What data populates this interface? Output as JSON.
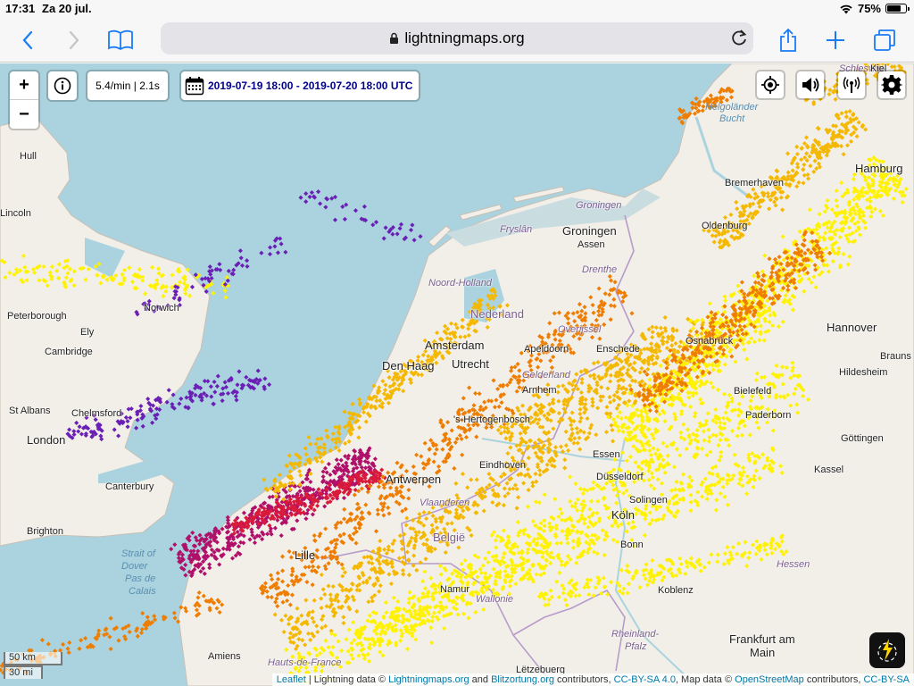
{
  "status_bar": {
    "time": "17:31",
    "date": "Za 20 jul.",
    "battery": "75%",
    "battery_level": 0.75,
    "icons": [
      "wifi-icon",
      "battery-icon"
    ]
  },
  "browser": {
    "url": "lightningmaps.org",
    "icons": [
      "back-chevron-icon",
      "forward-chevron-icon",
      "bookmarks-icon",
      "lock-icon",
      "reload-icon",
      "share-icon",
      "new-tab-icon",
      "tabs-icon"
    ]
  },
  "map_controls": {
    "zoom_in": "+",
    "zoom_out": "−",
    "rate": "5.4/min | 2.1s",
    "period": "2019-07-19 18:00 - 2019-07-20 18:00 UTC",
    "right_icons": [
      "locate-icon",
      "sound-icon",
      "stations-icon",
      "settings-icon"
    ]
  },
  "scale": {
    "km": "50 km",
    "mi": "30 mi"
  },
  "attribution": {
    "leaflet": "Leaflet",
    "sep1": " | Lightning data © ",
    "lm": "Lightningmaps.org",
    "and": " and ",
    "bo": "Blitzortung.org",
    "contrib": " contributors, ",
    "cc1": "CC-BY-SA 4.0",
    "mapdata": ", Map data © ",
    "osm": "OpenStreetMap",
    "contrib2": " contributors, ",
    "cc2": "CC-BY-SA"
  },
  "labels": {
    "hull": "Hull",
    "lincoln": "Lincoln",
    "peterborough": "Peterborough",
    "norwich": "Norwich",
    "ely": "Ely",
    "cambridge": "Cambridge",
    "st_albans": "St Albans",
    "chelmsford": "Chelmsford",
    "london": "London",
    "canterbury": "Canterbury",
    "brighton": "Brighton",
    "strait": "Strait of",
    "dover": "Dover",
    "pas": "Pas de",
    "calais": "Calais",
    "lille": "Lille",
    "amiens": "Amiens",
    "hauts": "Hauts-de-France",
    "groningen_prov": "Groningen",
    "groningen": "Groningen",
    "friesland": "Fryslân",
    "assen": "Assen",
    "drenthe": "Drenthe",
    "noord_holland": "Noord-Holland",
    "nederland": "Nederland",
    "amsterdam": "Amsterdam",
    "overijssel": "Overijssel",
    "apeldoorn": "Apeldoorn",
    "enschede": "Enschede",
    "den_haag": "Den Haag",
    "utrecht": "Utrecht",
    "gelderland": "Gelderland",
    "arnhem": "Arnhem",
    "hertogenbosch": "'s-Hertogenbosch",
    "eindhoven": "Eindhoven",
    "antwerpen": "Antwerpen",
    "vlaanderen": "Vlaanderen",
    "belgie": "België",
    "wallonie": "Wallonie",
    "namur": "Namur",
    "luxembourg": "Lëtzebuerg",
    "essen": "Essen",
    "dusseldorf": "Düsseldorf",
    "koln": "Köln",
    "bonn": "Bonn",
    "solingen": "Solingen",
    "koblenz": "Koblenz",
    "rheinland": "Rheinland-",
    "pfalz": "Pfalz",
    "frankfurt": "Frankfurt am",
    "main": "Main",
    "hessen": "Hessen",
    "oldenburg": "Oldenburg",
    "bremerhaven": "Bremerhaven",
    "hannover": "Hannover",
    "osnabruck": "Osnabrück",
    "bielefeld": "Bielefeld",
    "paderborn": "Paderborn",
    "gottingen": "Göttingen",
    "kassel": "Kassel",
    "hildesheim": "Hildesheim",
    "braunschweig": "Brauns",
    "schleswig": "Schleswig-",
    "kiel": "Kiel",
    "helgolander": "Helgoländer",
    "bucht": "Bucht",
    "hamburg": "Hamburg"
  },
  "colors": {
    "sea": "#aad3df",
    "land": "#f2efe9",
    "strike_old": "#6a1fb5",
    "strike_mid1": "#b0106a",
    "strike_mid2": "#d91a3a",
    "strike_mid3": "#ee7d00",
    "strike_new1": "#f5b800",
    "strike_new2": "#fff200"
  }
}
